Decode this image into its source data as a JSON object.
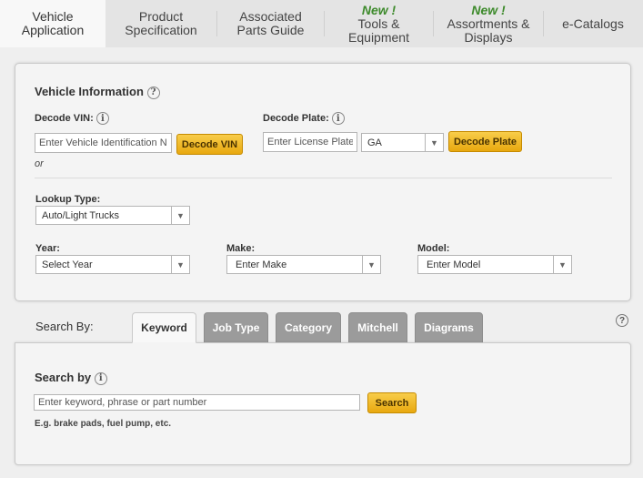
{
  "topnav": {
    "tabs": [
      {
        "label1": "Vehicle",
        "label2": "Application",
        "new": ""
      },
      {
        "label1": "Product",
        "label2": "Specification",
        "new": ""
      },
      {
        "label1": "Associated",
        "label2": "Parts Guide",
        "new": ""
      },
      {
        "label1": "Tools &",
        "label2": "Equipment",
        "new": "New !"
      },
      {
        "label1": "Assortments &",
        "label2": "Displays",
        "new": "New !"
      },
      {
        "label1": "e-Catalogs",
        "label2": "",
        "new": ""
      }
    ]
  },
  "vehicle": {
    "title": "Vehicle Information",
    "help_glyph": "?",
    "info_glyph": "i",
    "vin_label": "Decode VIN:",
    "vin_placeholder": "Enter Vehicle Identification Number",
    "vin_button": "Decode VIN",
    "or_text": "or",
    "plate_label": "Decode Plate:",
    "plate_placeholder": "Enter License Plate",
    "state_value": "GA",
    "plate_button": "Decode Plate",
    "lookup_label": "Lookup Type:",
    "lookup_value": "Auto/Light Trucks",
    "year_label": "Year:",
    "year_value": "Select Year",
    "make_label": "Make:",
    "make_value": "Enter Make",
    "model_label": "Model:",
    "model_value": "Enter Model"
  },
  "search": {
    "by_label": "Search By:",
    "tabs": [
      "Keyword",
      "Job Type",
      "Category",
      "Mitchell",
      "Diagrams"
    ],
    "help_glyph": "?",
    "title": "Search by",
    "info_glyph": "i",
    "input_value": "Enter keyword, phrase or part number",
    "button": "Search",
    "hint": "E.g. brake pads, fuel pump, etc."
  },
  "colors": {
    "accent_button": "#e8a80f",
    "new_badge": "#3d8a2b",
    "inactive_tab": "#9b9b9b"
  }
}
